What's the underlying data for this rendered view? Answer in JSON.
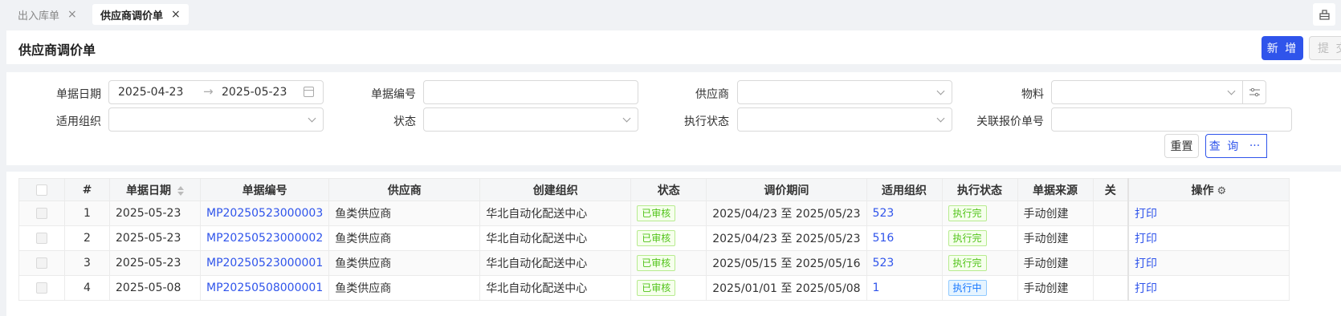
{
  "tabs": [
    {
      "label": "出入库单",
      "close": "×",
      "active": false
    },
    {
      "label": "供应商调价单",
      "close": "×",
      "active": true
    }
  ],
  "header": {
    "title": "供应商调价单",
    "new_label": "新 增",
    "submit_label": "提 交"
  },
  "filters": {
    "date_label": "单据日期",
    "date_start": "2025-04-23",
    "date_end": "2025-05-23",
    "date_sep": "→",
    "doc_no_label": "单据编号",
    "supplier_label": "供应商",
    "material_label": "物料",
    "org_label": "适用组织",
    "status_label": "状态",
    "exec_status_label": "执行状态",
    "quote_no_label": "关联报价单号",
    "reset_label": "重置",
    "query_label": "查 询",
    "more_label": "···"
  },
  "table": {
    "columns": [
      "#",
      "单据日期",
      "单据编号",
      "供应商",
      "创建组织",
      "状态",
      "调价期间",
      "适用组织",
      "执行状态",
      "单据来源",
      "关",
      "操作"
    ],
    "rows": [
      {
        "idx": "1",
        "date": "2025-05-23",
        "doc_no": "MP20250523000003",
        "supplier": "鱼类供应商",
        "org": "华北自动化配送中心",
        "status": "已审核",
        "period": "2025/04/23 至 2025/05/23",
        "apply_org": "523",
        "exec": "执行完",
        "source": "手动创建",
        "action": "打印"
      },
      {
        "idx": "2",
        "date": "2025-05-23",
        "doc_no": "MP20250523000002",
        "supplier": "鱼类供应商",
        "org": "华北自动化配送中心",
        "status": "已审核",
        "period": "2025/04/23 至 2025/05/23",
        "apply_org": "516",
        "exec": "执行完",
        "source": "手动创建",
        "action": "打印"
      },
      {
        "idx": "3",
        "date": "2025-05-23",
        "doc_no": "MP20250523000001",
        "supplier": "鱼类供应商",
        "org": "华北自动化配送中心",
        "status": "已审核",
        "period": "2025/05/15 至 2025/05/16",
        "apply_org": "523",
        "exec": "执行完",
        "source": "手动创建",
        "action": "打印"
      },
      {
        "idx": "4",
        "date": "2025-05-08",
        "doc_no": "MP20250508000001",
        "supplier": "鱼类供应商",
        "org": "华北自动化配送中心",
        "status": "已审核",
        "period": "2025/01/01 至 2025/05/08",
        "apply_org": "1",
        "exec": "执行中",
        "source": "手动创建",
        "action": "打印"
      }
    ]
  },
  "colors": {
    "primary": "#2f54eb",
    "green": "#52c41a",
    "blue": "#1677ff"
  }
}
